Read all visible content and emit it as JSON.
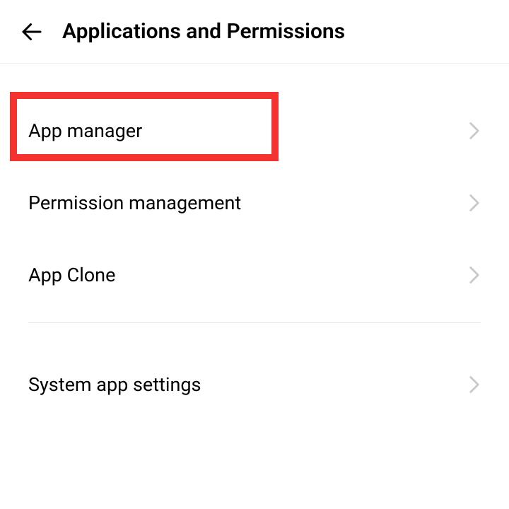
{
  "header": {
    "title": "Applications and Permissions"
  },
  "items": {
    "app_manager": {
      "label": "App manager"
    },
    "permission_management": {
      "label": "Permission management"
    },
    "app_clone": {
      "label": "App Clone"
    },
    "system_app_settings": {
      "label": "System app settings"
    }
  }
}
